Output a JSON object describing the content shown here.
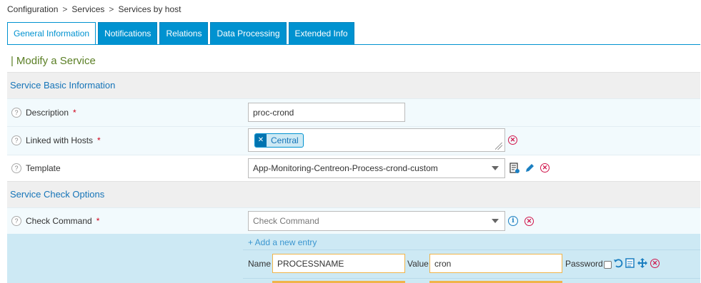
{
  "breadcrumb": [
    "Configuration",
    "Services",
    "Services by host"
  ],
  "tabs": [
    "General Information",
    "Notifications",
    "Relations",
    "Data Processing",
    "Extended Info"
  ],
  "page_title": "Modify a Service",
  "sections": {
    "basic": "Service Basic Information",
    "check": "Service Check Options"
  },
  "fields": {
    "description": {
      "label": "Description",
      "required": "*",
      "value": "proc-crond"
    },
    "linked_hosts": {
      "label": "Linked with Hosts",
      "required": "*",
      "tags": [
        "Central"
      ]
    },
    "template": {
      "label": "Template",
      "value": "App-Monitoring-Centreon-Process-crond-custom"
    },
    "check_command": {
      "label": "Check Command",
      "required": "*",
      "placeholder": "Check Command"
    }
  },
  "macros": {
    "add_entry": "+ Add a new entry",
    "name_label": "Name",
    "value_label": "Value",
    "password_label": "Password",
    "rows": [
      {
        "name": "PROCESSNAME",
        "value": "cron"
      }
    ]
  },
  "colors": {
    "accent": "#0092d0",
    "title": "#5b7f25",
    "delete": "#d0144a",
    "section_text": "#1574b8"
  }
}
